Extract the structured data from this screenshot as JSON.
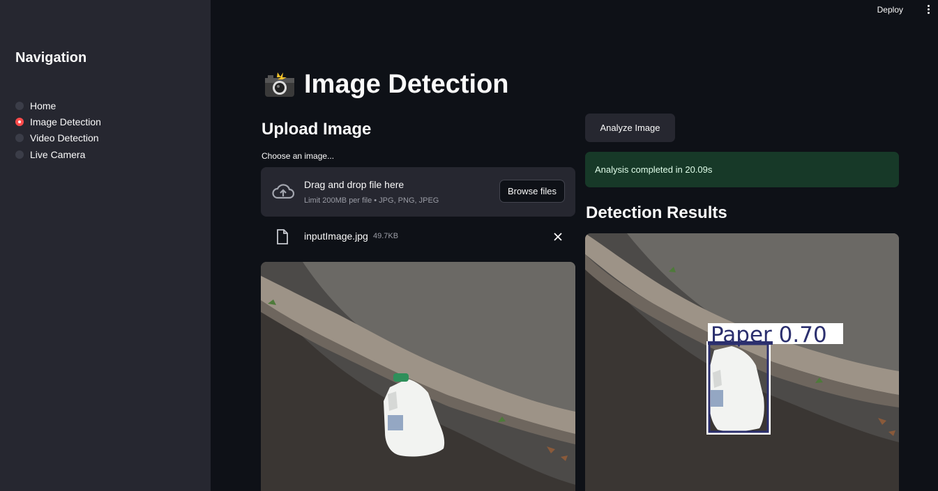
{
  "topbar": {
    "deploy_label": "Deploy"
  },
  "sidebar": {
    "title": "Navigation",
    "items": [
      {
        "label": "Home",
        "selected": false
      },
      {
        "label": "Image Detection",
        "selected": true
      },
      {
        "label": "Video Detection",
        "selected": false
      },
      {
        "label": "Live Camera",
        "selected": false
      }
    ]
  },
  "page": {
    "title": "Image Detection",
    "title_icon": "camera-flash-icon"
  },
  "upload": {
    "heading": "Upload Image",
    "field_label": "Choose an image...",
    "dropzone_title": "Drag and drop file here",
    "dropzone_limit": "Limit 200MB per file • JPG, PNG, JPEG",
    "browse_label": "Browse files",
    "file": {
      "name": "inputImage.jpg",
      "size": "49.7KB"
    }
  },
  "analysis": {
    "analyze_label": "Analyze Image",
    "status_message": "Analysis completed in 20.09s",
    "results_heading": "Detection Results",
    "detection": {
      "class": "Paper",
      "confidence": "0.70",
      "label": "Paper 0.70"
    }
  },
  "colors": {
    "accent": "#ff4b4b",
    "background": "#0e1117",
    "sidebar": "#262730",
    "success_bg": "#173928",
    "bbox": "#2b2f6e"
  }
}
